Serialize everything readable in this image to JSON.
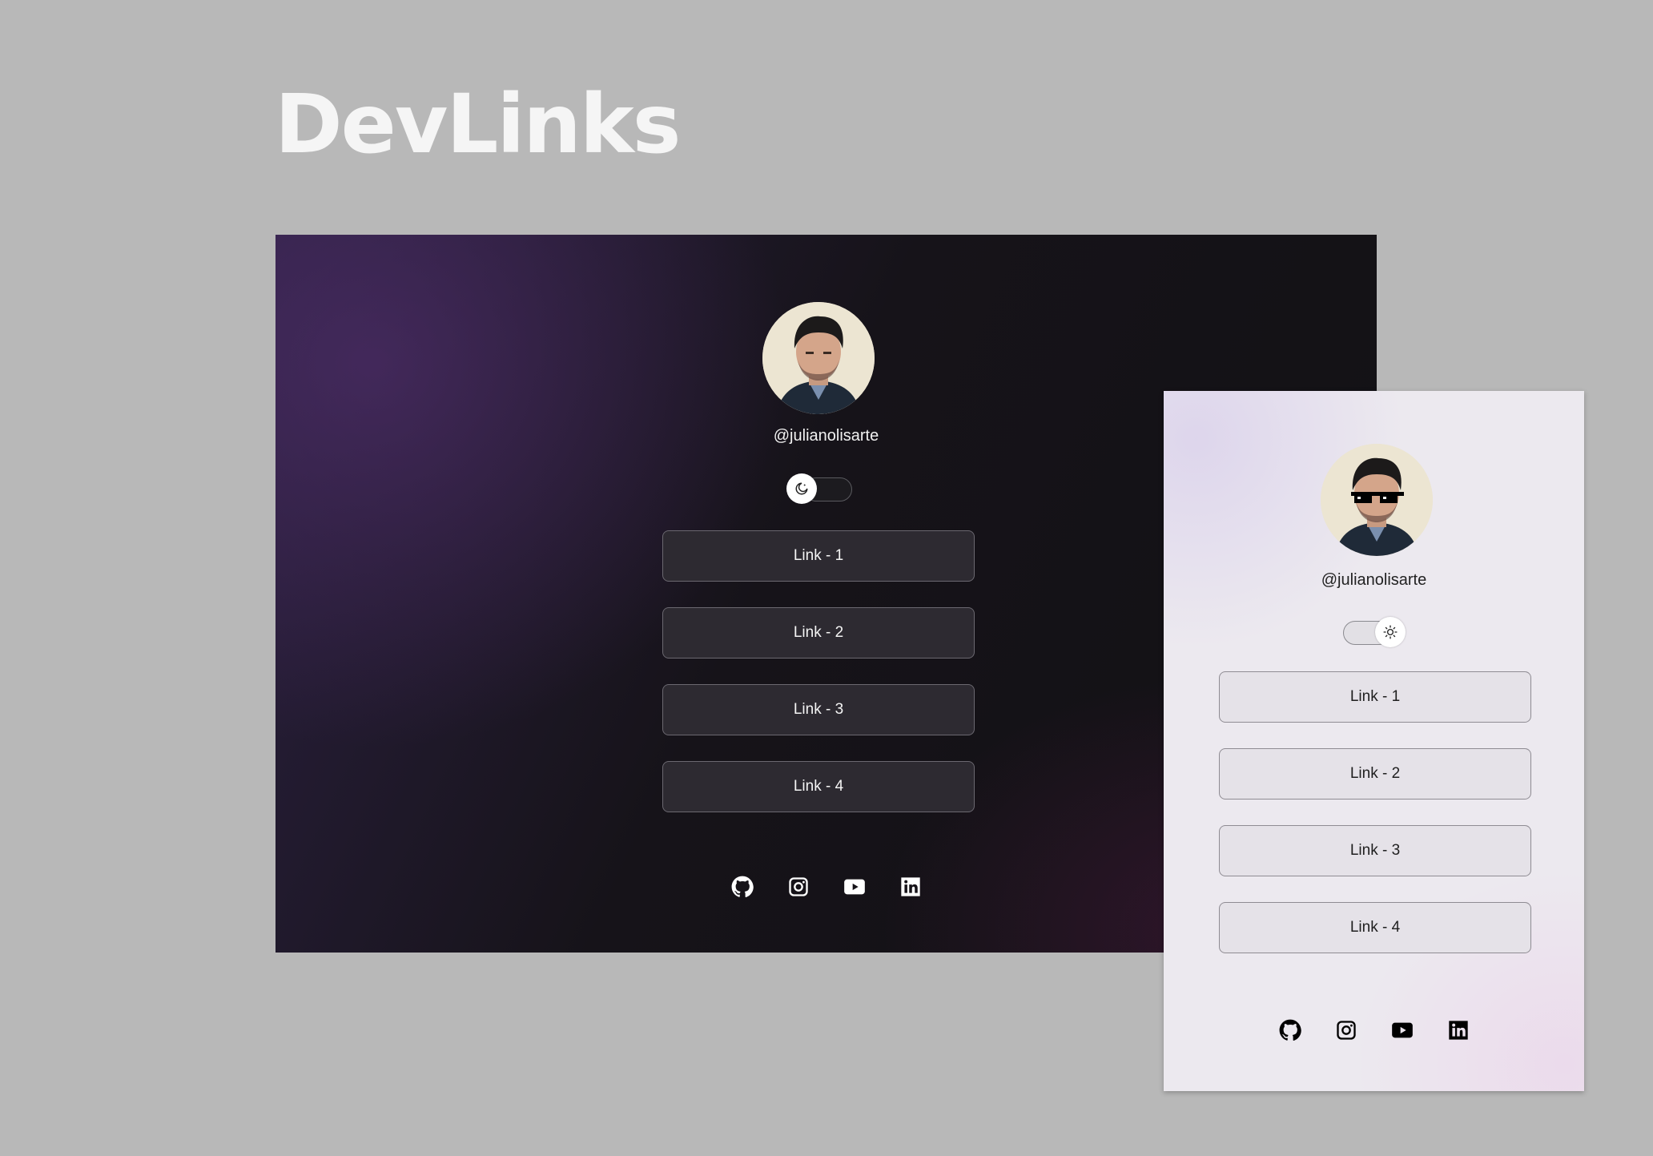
{
  "header": {
    "title": "DevLinks"
  },
  "dark_view": {
    "username": "@julianolisarte",
    "theme_toggle": {
      "mode": "dark",
      "icon": "moon-icon"
    },
    "links": [
      {
        "label": "Link - 1"
      },
      {
        "label": "Link - 2"
      },
      {
        "label": "Link - 3"
      },
      {
        "label": "Link - 4"
      }
    ],
    "socials": [
      "github-icon",
      "instagram-icon",
      "youtube-icon",
      "linkedin-icon"
    ]
  },
  "light_view": {
    "username": "@julianolisarte",
    "theme_toggle": {
      "mode": "light",
      "icon": "sun-icon"
    },
    "links": [
      {
        "label": "Link - 1"
      },
      {
        "label": "Link - 2"
      },
      {
        "label": "Link - 3"
      },
      {
        "label": "Link - 4"
      }
    ],
    "socials": [
      "github-icon",
      "instagram-icon",
      "youtube-icon",
      "linkedin-icon"
    ]
  },
  "colors": {
    "background": "#b8b8b8",
    "dark_card": "#121114",
    "dark_accent": "#2b2040",
    "light_card": "#ece9ef",
    "link_dark": "#2d2a31",
    "link_light": "#e5e2e8"
  }
}
